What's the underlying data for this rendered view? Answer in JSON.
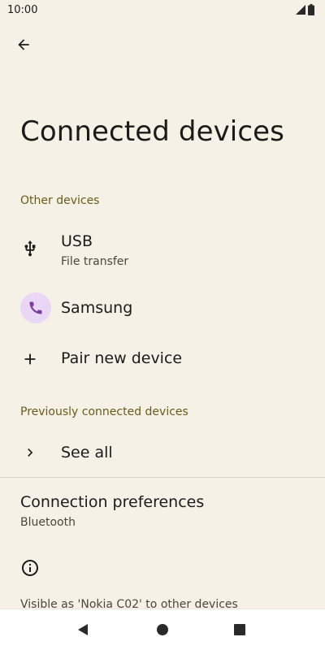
{
  "status_bar": {
    "time": "10:00",
    "icons": [
      "signal-icon",
      "battery-icon"
    ]
  },
  "header": {
    "back_icon": "arrow-back-icon",
    "title": "Connected devices"
  },
  "other_devices": {
    "header": "Other devices",
    "items": [
      {
        "icon": "usb-icon",
        "title": "USB",
        "subtitle": "File transfer"
      },
      {
        "icon": "phone-icon",
        "title": "Samsung"
      },
      {
        "icon": "plus-icon",
        "title": "Pair new device"
      }
    ]
  },
  "previously_connected": {
    "header": "Previously connected devices",
    "see_all_label": "See all",
    "see_all_icon": "chevron-right-icon"
  },
  "connection_preferences": {
    "title": "Connection preferences",
    "subtitle": "Bluetooth"
  },
  "info": {
    "icon": "info-icon",
    "text": "Visible as 'Nokia C02' to other devices"
  },
  "nav_bar": {
    "buttons": [
      "back-triangle-icon",
      "home-circle-icon",
      "recents-square-icon"
    ]
  },
  "colors": {
    "background": "#f6f1e7",
    "section_header": "#6a5b18",
    "avatar_bg": "#ead6f5",
    "avatar_icon": "#7e3fa0"
  }
}
